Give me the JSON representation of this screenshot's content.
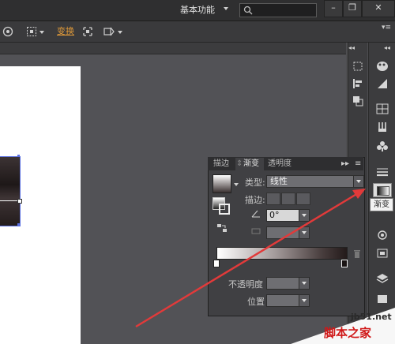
{
  "titlebar": {
    "workspace": "基本功能",
    "window_controls": [
      "–",
      "❐",
      "✕"
    ]
  },
  "controlbar": {
    "transform_label": "变换"
  },
  "gradient_panel": {
    "tabs": [
      "描边",
      "渐变",
      "透明度"
    ],
    "type_label": "类型:",
    "type_value": "线性",
    "stroke_label": "描边:",
    "angle_value": "0°",
    "opacity_label": "不透明度",
    "position_label": "位置"
  },
  "tooltip": "渐变",
  "watermark": {
    "url": "jb51.net",
    "name": "脚本之家"
  },
  "colors": {
    "arrow": "#e23a3a",
    "selection": "#5a6fe0"
  }
}
